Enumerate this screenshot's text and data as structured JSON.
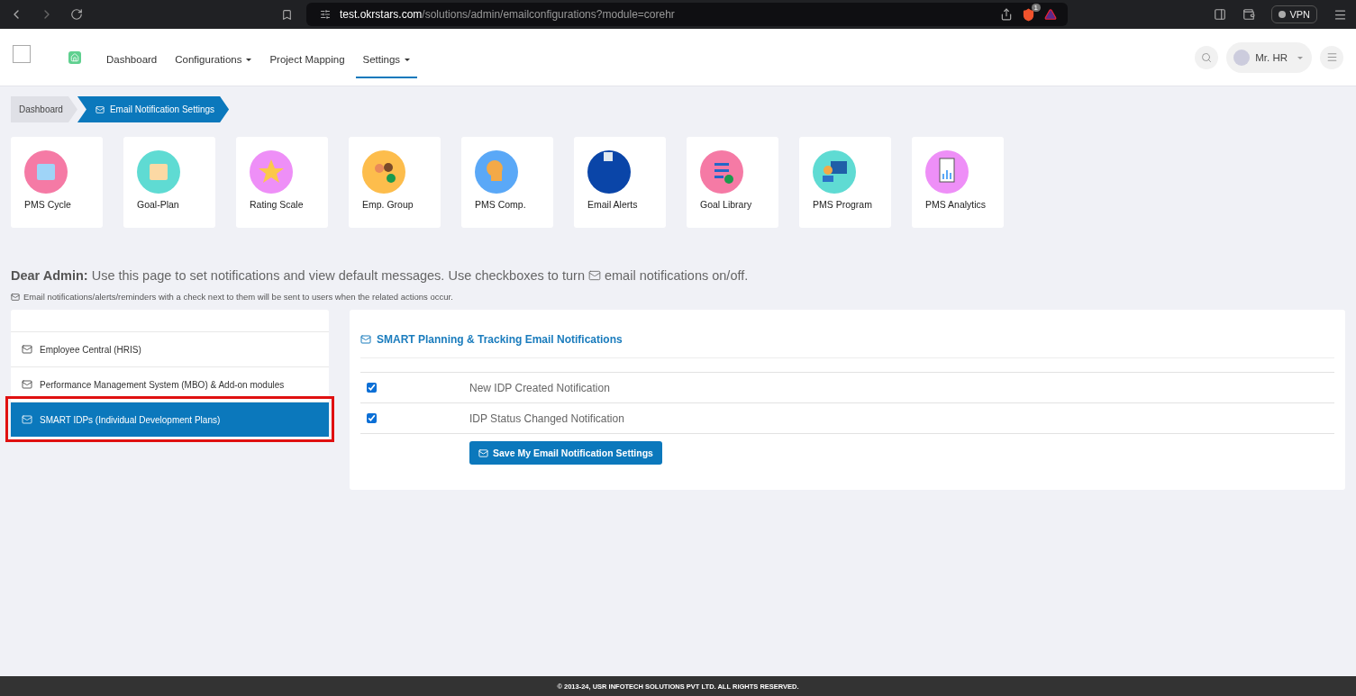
{
  "browser": {
    "url_host": "test.okrstars.com",
    "url_path": "/solutions/admin/emailconfigurations?module=corehr",
    "shield_count": "1",
    "vpn": "VPN"
  },
  "nav": {
    "items": [
      {
        "label": "Dashboard",
        "selected": false,
        "dropdown": false
      },
      {
        "label": "Configurations",
        "selected": false,
        "dropdown": true
      },
      {
        "label": "Project Mapping",
        "selected": false,
        "dropdown": false
      },
      {
        "label": "Settings",
        "selected": true,
        "dropdown": true
      }
    ],
    "user": "Mr. HR"
  },
  "breadcrumb": [
    {
      "label": "Dashboard",
      "kind": "link"
    },
    {
      "label": "Email Notification Settings",
      "kind": "current"
    }
  ],
  "tiles": [
    {
      "label": "PMS Cycle",
      "kind": "calendar",
      "color": "#f57aa5"
    },
    {
      "label": "Goal-Plan",
      "kind": "plan",
      "color": "#5fdbd3"
    },
    {
      "label": "Rating Scale",
      "kind": "star",
      "color": "#ee8ff7"
    },
    {
      "label": "Emp. Group",
      "kind": "people",
      "color": "#fdbd4c"
    },
    {
      "label": "PMS Comp.",
      "kind": "head",
      "color": "#5aa8f7"
    },
    {
      "label": "Email Alerts",
      "kind": "image",
      "color": "#0a45a8"
    },
    {
      "label": "Goal Library",
      "kind": "list",
      "color": "#f57aa5"
    },
    {
      "label": "PMS Program",
      "kind": "presenter",
      "color": "#5fdbd3"
    },
    {
      "label": "PMS Analytics",
      "kind": "chart",
      "color": "#ee8ff7"
    }
  ],
  "intro": {
    "lead": "Dear Admin:",
    "text_before": "Use this page to set notifications and view default messages. Use checkboxes to turn",
    "text_after": "email notifications on/off.",
    "note": "Email notifications/alerts/reminders with a check next to them will be sent to users when the related actions occur."
  },
  "modules": [
    {
      "label": "Employee Central (HRIS)",
      "selected": false,
      "highlighted": false
    },
    {
      "label": "Performance Management System (MBO) & Add-on modules",
      "selected": false,
      "highlighted": false
    },
    {
      "label": "SMART IDPs (Individual Development Plans)",
      "selected": true,
      "highlighted": true
    }
  ],
  "panel": {
    "title": "SMART Planning & Tracking Email Notifications",
    "notifications": [
      {
        "label": "New IDP Created Notification",
        "checked": true
      },
      {
        "label": "IDP Status Changed Notification",
        "checked": true
      }
    ],
    "save_button": "Save My Email Notification Settings"
  },
  "footer": "© 2013-24, USR INFOTECH SOLUTIONS PVT LTD. ALL RIGHTS RESERVED."
}
